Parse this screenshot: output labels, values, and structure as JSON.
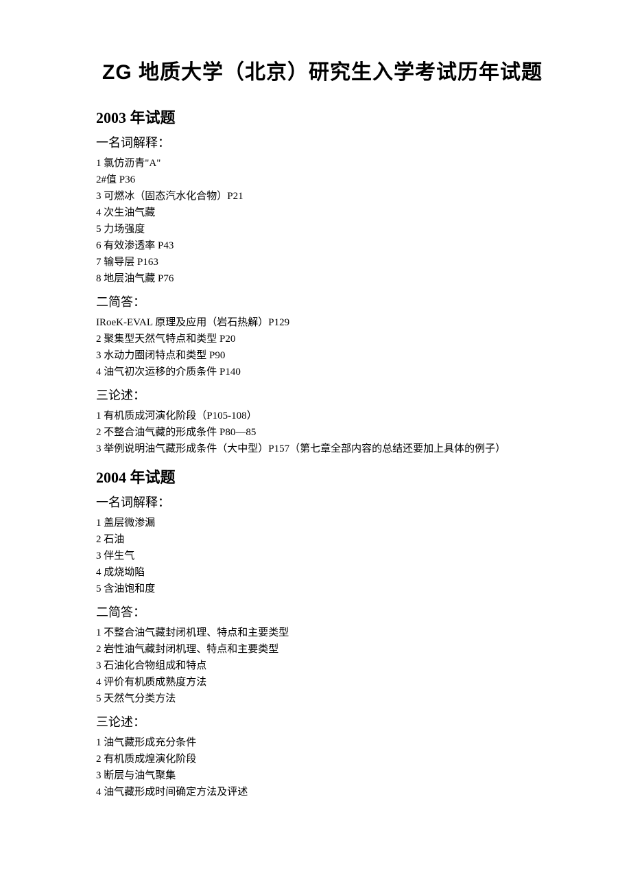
{
  "title": "ZG 地质大学（北京）研究生入学考试历年试题",
  "years": [
    {
      "year_heading": "2003 年试题",
      "sections": [
        {
          "heading": "一名词解释：",
          "items": [
            "1 氯仿沥青\"A\"",
            "2#值 P36",
            "3 可燃冰（固态汽水化合物）P21",
            "4 次生油气藏",
            "5 力场强度",
            "6 有效渗透率 P43",
            "7 输导层 P163",
            "8 地层油气藏 P76"
          ]
        },
        {
          "heading": "二简答：",
          "items": [
            "IRoeK-EVAL 原理及应用（岩石热解）P129",
            "2 聚集型天然气特点和类型 P20",
            "3 水动力圈闭特点和类型 P90",
            "4 油气初次运移的介质条件 P140"
          ]
        },
        {
          "heading": "三论述：",
          "items": [
            "1 有机质成河演化阶段（P105-108）",
            "2 不整合油气藏的形成条件 P80—85",
            "3 举例说明油气藏形成条件（大中型）P157（第七章全部内容的总结还要加上具体的例子）"
          ]
        }
      ]
    },
    {
      "year_heading": "2004 年试题",
      "sections": [
        {
          "heading": "一名词解释：",
          "items": [
            "1 盖层微渗漏",
            "2 石油",
            "3 伴生气",
            "4 成烧坳陷",
            "5 含油饱和度"
          ]
        },
        {
          "heading": "二简答：",
          "items": [
            "1 不整合油气藏封闭机理、特点和主要类型",
            "2 岩性油气藏封闭机理、特点和主要类型",
            "3 石油化合物组成和特点",
            "4 评价有机质成熟度方法",
            "5 天然气分类方法"
          ]
        },
        {
          "heading": "三论述：",
          "items": [
            "1 油气藏形成充分条件",
            "2 有机质成煌演化阶段",
            "3 断层与油气聚集",
            "4 油气藏形成时间确定方法及评述"
          ]
        }
      ]
    }
  ]
}
